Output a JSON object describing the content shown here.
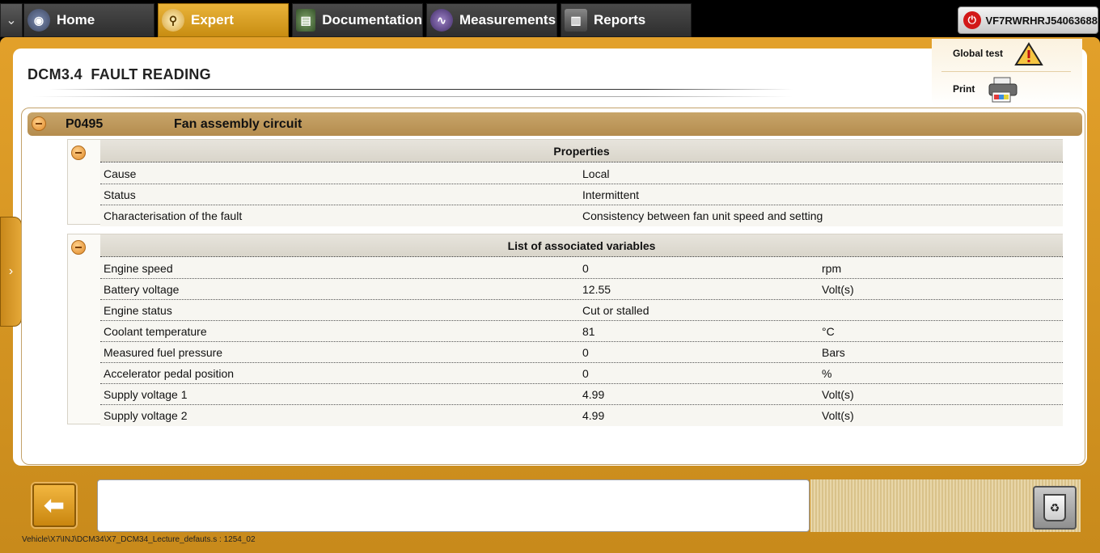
{
  "nav": {
    "tabs": [
      {
        "label": "Home",
        "icon": "home-icon"
      },
      {
        "label": "Expert",
        "icon": "magnifier-icon"
      },
      {
        "label": "Documentation",
        "icon": "book-icon"
      },
      {
        "label": "Measurements",
        "icon": "waveform-icon"
      },
      {
        "label": "Reports",
        "icon": "report-icon"
      }
    ],
    "active_tab": "Expert",
    "vin": "VF7RWRHRJ54063688"
  },
  "page": {
    "title": "DCM3.4  FAULT READING"
  },
  "side_tools": {
    "global_test": "Global test",
    "print": "Print"
  },
  "fault": {
    "code": "P0495",
    "description": "Fan assembly circuit"
  },
  "properties": {
    "heading": "Properties",
    "rows": [
      {
        "name": "Cause",
        "value": "Local"
      },
      {
        "name": "Status",
        "value": "Intermittent"
      },
      {
        "name": "Characterisation of the fault",
        "value": "Consistency between fan unit speed and setting"
      }
    ]
  },
  "variables": {
    "heading": "List of associated variables",
    "rows": [
      {
        "name": "Engine speed",
        "value": "0",
        "unit": "rpm"
      },
      {
        "name": "Battery voltage",
        "value": "12.55",
        "unit": "Volt(s)"
      },
      {
        "name": "Engine status",
        "value": "Cut or stalled",
        "unit": ""
      },
      {
        "name": "Coolant temperature",
        "value": "81",
        "unit": "°C"
      },
      {
        "name": "Measured fuel pressure",
        "value": "0",
        "unit": "Bars"
      },
      {
        "name": "Accelerator pedal position",
        "value": "0",
        "unit": "%"
      },
      {
        "name": "Supply voltage 1",
        "value": "4.99",
        "unit": "Volt(s)"
      },
      {
        "name": "Supply voltage 2",
        "value": "4.99",
        "unit": "Volt(s)"
      }
    ]
  },
  "footer": {
    "path": "Vehicle\\X7\\INJ\\DCM34\\X7_DCM34_Lecture_defauts.s : 1254_02"
  },
  "colors": {
    "accent": "#e2a02a",
    "header_bar": "#b48c4e"
  }
}
